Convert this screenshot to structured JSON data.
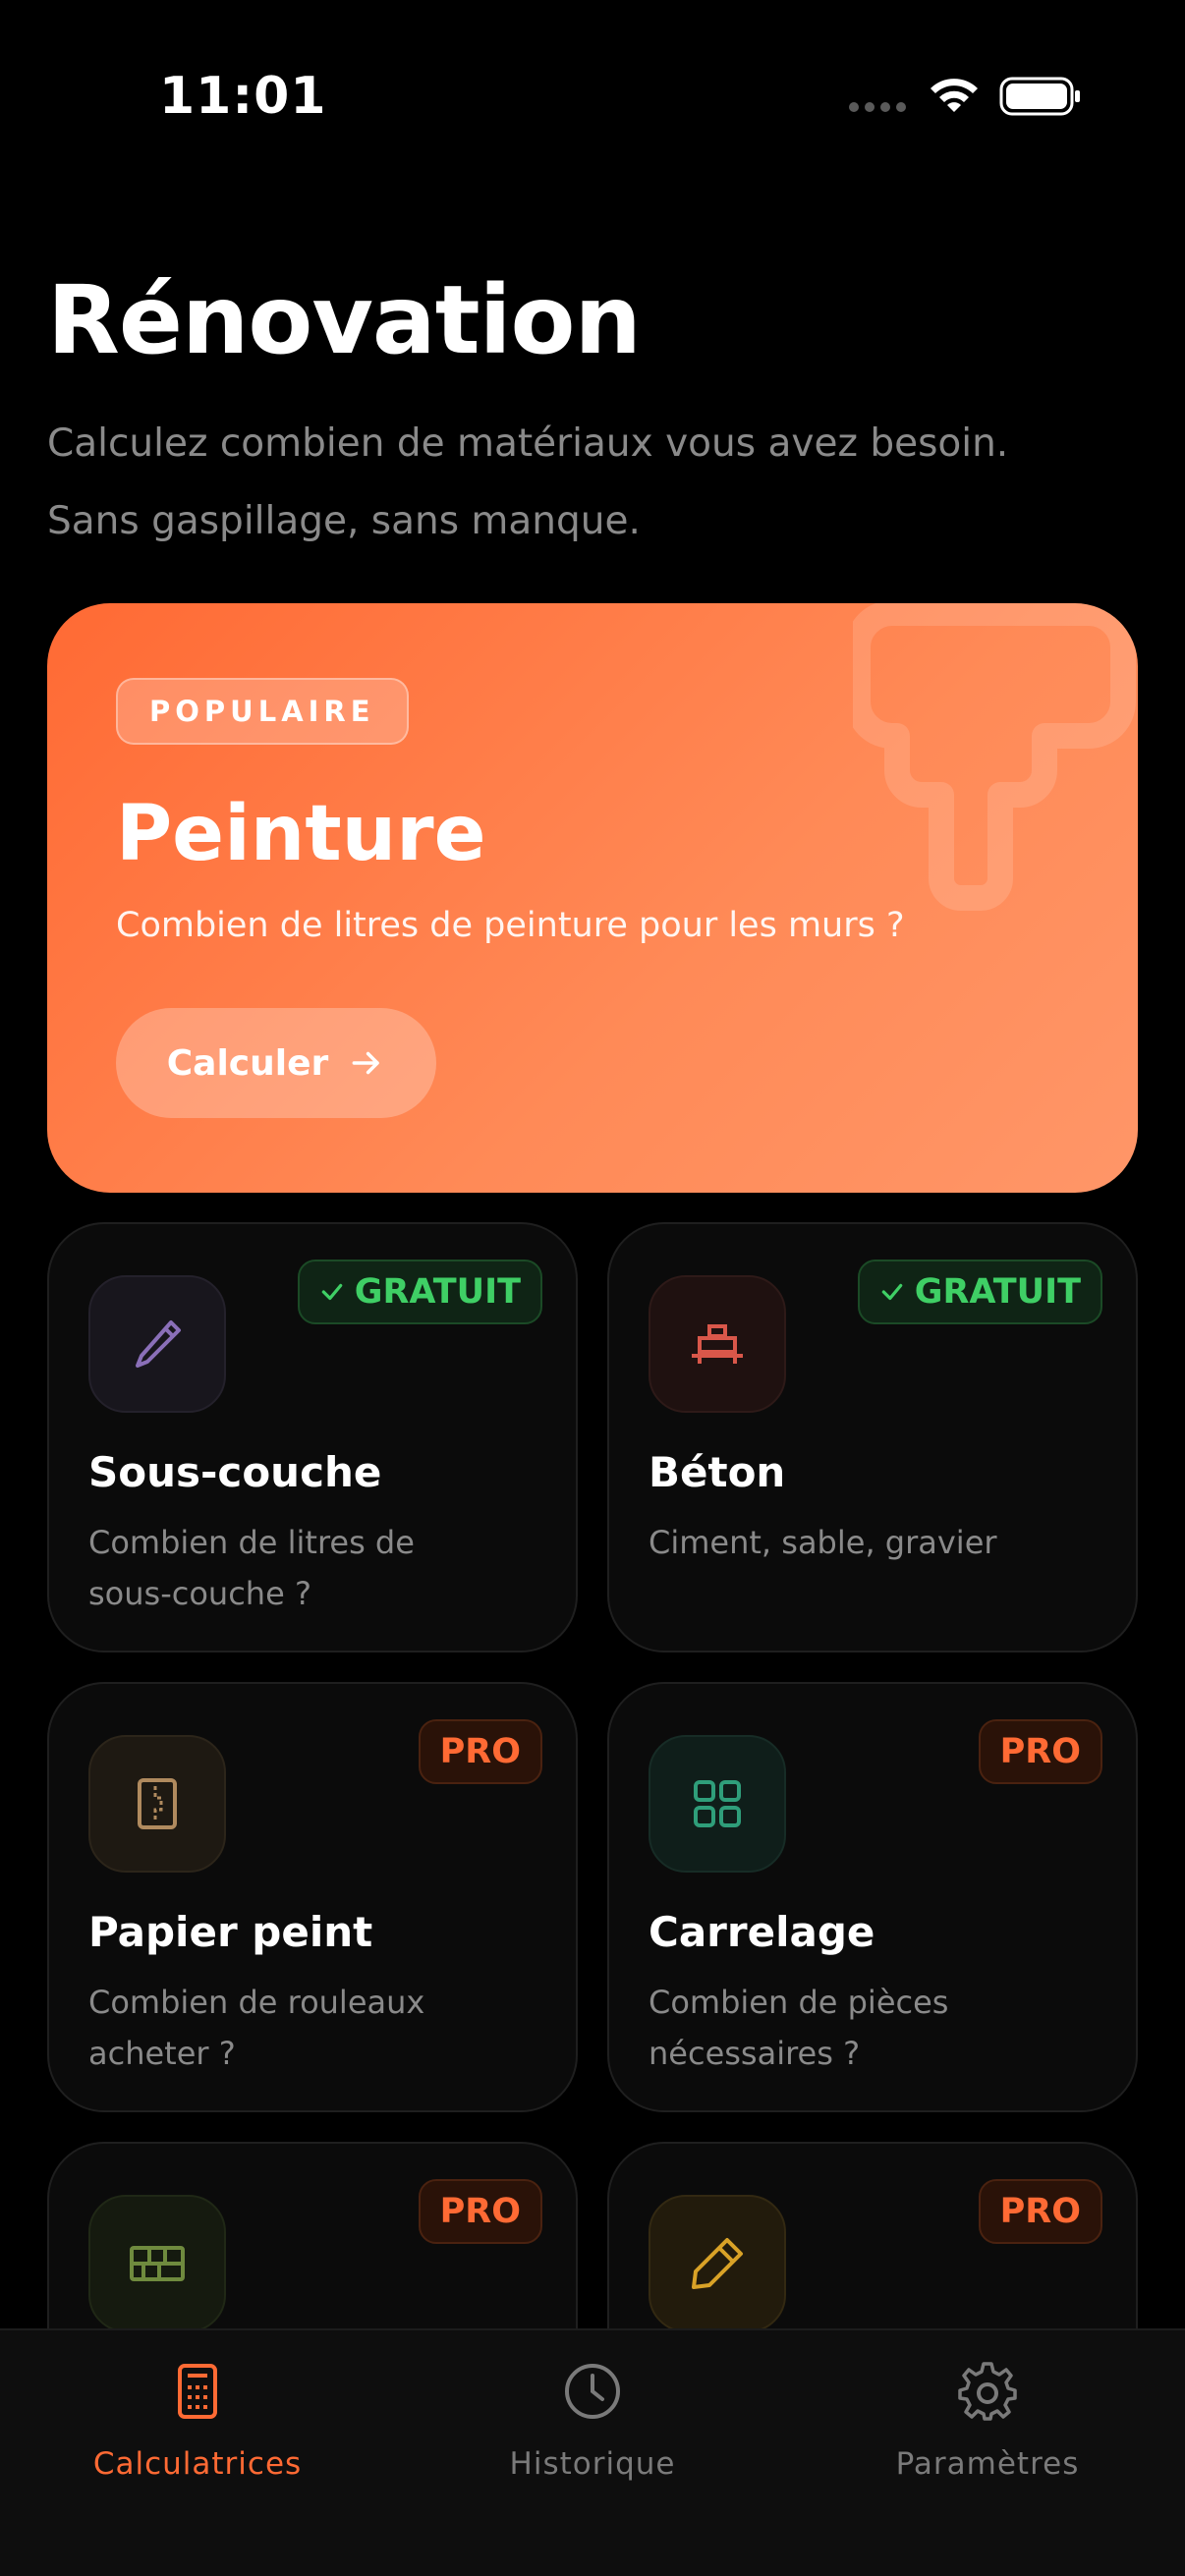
{
  "status_bar": {
    "time": "11:01",
    "icons": [
      "signal-dots-icon",
      "wifi-icon",
      "battery-icon"
    ]
  },
  "header": {
    "title": "Rénovation",
    "subtitle_line1": "Calculez combien de matériaux vous avez besoin.",
    "subtitle_line2": "Sans gaspillage, sans manque."
  },
  "hero": {
    "badge": "POPULAIRE",
    "title": "Peinture",
    "description": "Combien de litres de peinture pour les murs ?",
    "button_label": "Calculer",
    "icon": "paint-roller-icon",
    "colors": {
      "gradient_start": "#ff6a34",
      "gradient_end": "#ff9668"
    }
  },
  "cards": [
    {
      "title": "Sous-couche",
      "description": "Combien de litres de sous-couche ?",
      "tag": "GRATUIT",
      "icon": "brush-icon",
      "icon_color": "#8a6fb8",
      "icon_bg": "#18161d"
    },
    {
      "title": "Béton",
      "description": "Ciment, sable, gravier",
      "tag": "GRATUIT",
      "icon": "concrete-mixer-icon",
      "icon_color": "#d9574a",
      "icon_bg": "#1f1110"
    },
    {
      "title": "Papier peint",
      "description": "Combien de rouleaux acheter ?",
      "tag": "PRO",
      "icon": "wallpaper-icon",
      "icon_color": "#b08a5e",
      "icon_bg": "#1e1912"
    },
    {
      "title": "Carrelage",
      "description": "Combien de pièces nécessaires ?",
      "tag": "PRO",
      "icon": "tiles-grid-icon",
      "icon_color": "#2f9e7a",
      "icon_bg": "#0f1e1a"
    },
    {
      "title": "",
      "description": "",
      "tag": "PRO",
      "icon": "bricks-icon",
      "icon_color": "#6f8a3e",
      "icon_bg": "#151a0f"
    },
    {
      "title": "",
      "description": "",
      "tag": "PRO",
      "icon": "pencil-icon",
      "icon_color": "#d9a227",
      "icon_bg": "#221b0c"
    }
  ],
  "tabs": [
    {
      "label": "Calculatrices",
      "icon": "calculator-icon",
      "active": true
    },
    {
      "label": "Historique",
      "icon": "clock-icon",
      "active": false
    },
    {
      "label": "Paramètres",
      "icon": "gear-icon",
      "active": false
    }
  ],
  "colors": {
    "accent": "#ff6a34",
    "free_green": "#3fcf65",
    "background": "#000000"
  }
}
